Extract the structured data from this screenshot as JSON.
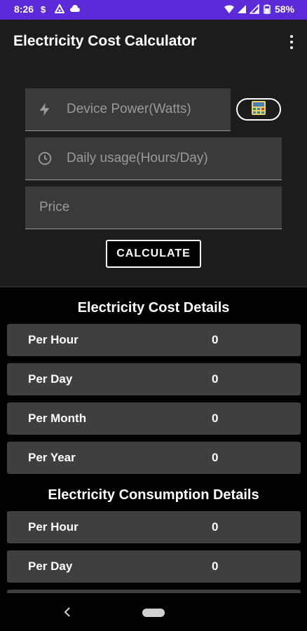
{
  "status_bar": {
    "time": "8:26",
    "battery": "58%"
  },
  "app_bar": {
    "title": "Electricity Cost Calculator"
  },
  "form": {
    "power_placeholder": "Device Power(Watts)",
    "usage_placeholder": "Daily usage(Hours/Day)",
    "price_placeholder": "Price",
    "calculate_label": "CALCULATE"
  },
  "cost_details": {
    "title": "Electricity Cost Details",
    "rows": [
      {
        "label": "Per Hour",
        "value": "0"
      },
      {
        "label": "Per Day",
        "value": "0"
      },
      {
        "label": "Per Month",
        "value": "0"
      },
      {
        "label": "Per Year",
        "value": "0"
      }
    ]
  },
  "consumption_details": {
    "title": "Electricity Consumption Details",
    "rows": [
      {
        "label": "Per Hour",
        "value": "0"
      },
      {
        "label": "Per Day",
        "value": "0"
      }
    ]
  },
  "colors": {
    "status_bar": "#5b2bd9",
    "app_surface": "#1c1c1c",
    "field_bg": "#3a3a3a",
    "row_bg": "#3f3f3f"
  }
}
